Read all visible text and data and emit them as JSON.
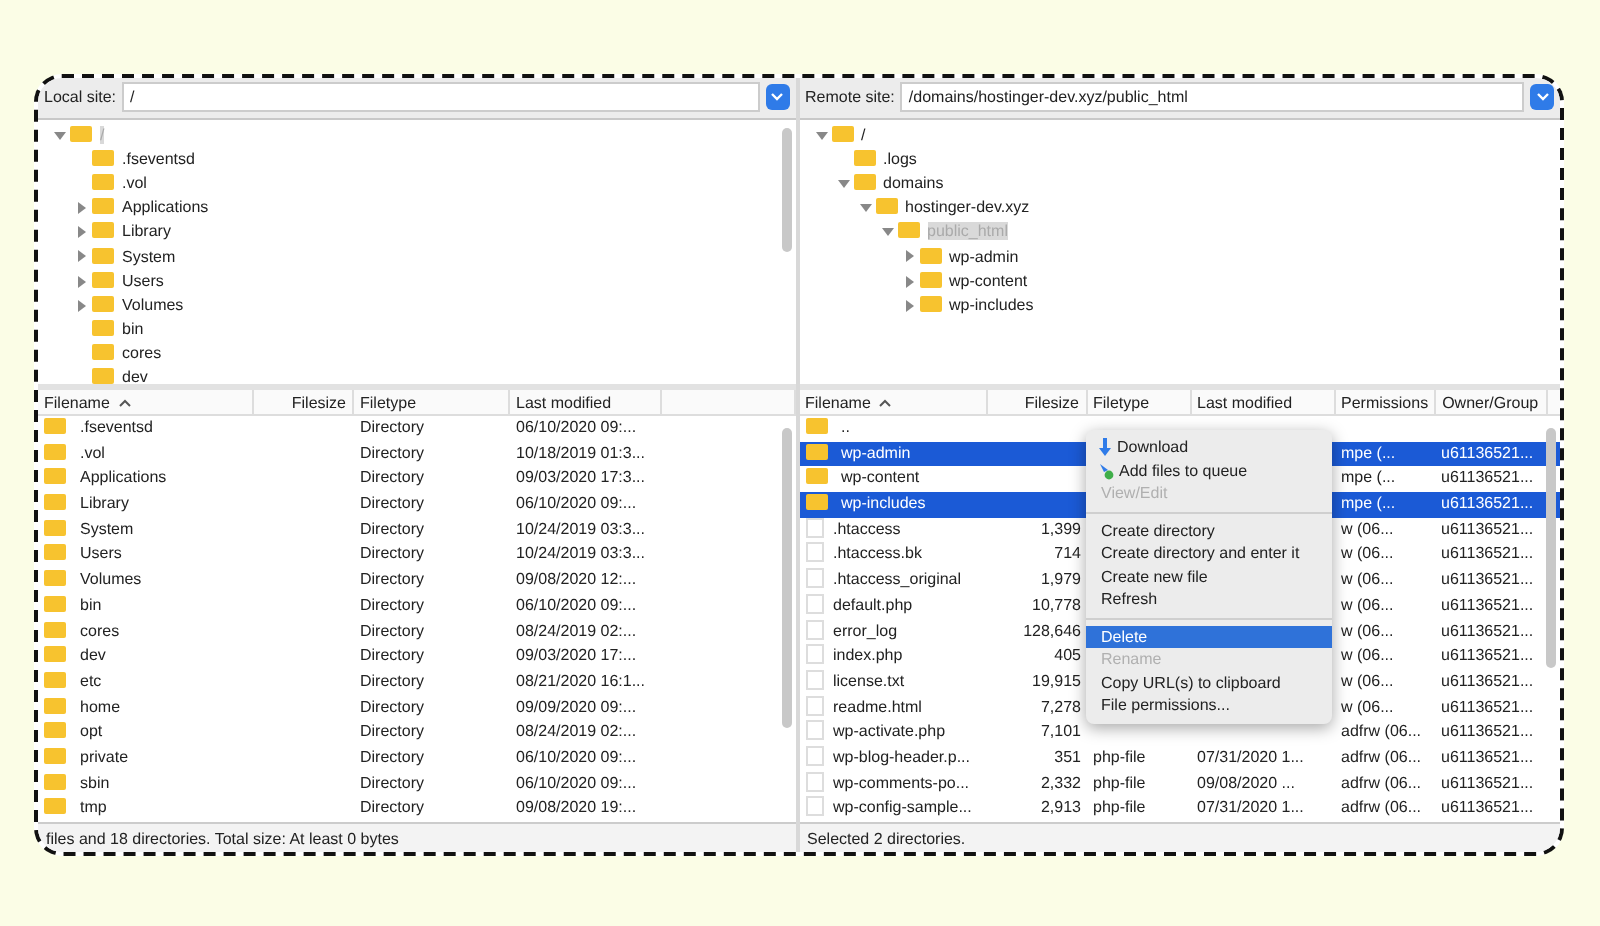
{
  "local": {
    "site_label": "Local site:",
    "path": "/",
    "tree": [
      {
        "label": "/",
        "expandable": true,
        "expanded": true,
        "selected": true,
        "children": [
          {
            "label": ".fseventsd",
            "expandable": false,
            "selected": false
          },
          {
            "label": ".vol",
            "expandable": false,
            "selected": false
          },
          {
            "label": "Applications",
            "expandable": true,
            "expanded": false,
            "selected": false
          },
          {
            "label": "Library",
            "expandable": true,
            "expanded": false,
            "selected": false
          },
          {
            "label": "System",
            "expandable": true,
            "expanded": false,
            "selected": false
          },
          {
            "label": "Users",
            "expandable": true,
            "expanded": false,
            "selected": false
          },
          {
            "label": "Volumes",
            "expandable": true,
            "expanded": false,
            "selected": false
          },
          {
            "label": "bin",
            "expandable": false,
            "selected": false
          },
          {
            "label": "cores",
            "expandable": false,
            "selected": false
          },
          {
            "label": "dev",
            "expandable": false,
            "selected": false
          }
        ]
      }
    ],
    "columns": [
      {
        "label": "Filename",
        "sorted": true
      },
      {
        "label": "Filesize",
        "sorted": false
      },
      {
        "label": "Filetype",
        "sorted": false
      },
      {
        "label": "Last modified",
        "sorted": false
      }
    ],
    "rows": [
      {
        "kind": "folder",
        "selected": false,
        "filename": ".fseventsd",
        "filetype": "Directory",
        "last_modified": "06/10/2020 09:..."
      },
      {
        "kind": "folder",
        "selected": false,
        "filename": ".vol",
        "filetype": "Directory",
        "last_modified": "10/18/2019 01:3..."
      },
      {
        "kind": "folder",
        "selected": false,
        "filename": "Applications",
        "filetype": "Directory",
        "last_modified": "09/03/2020 17:3..."
      },
      {
        "kind": "folder",
        "selected": false,
        "filename": "Library",
        "filetype": "Directory",
        "last_modified": "06/10/2020 09:..."
      },
      {
        "kind": "folder",
        "selected": false,
        "filename": "System",
        "filetype": "Directory",
        "last_modified": "10/24/2019 03:3..."
      },
      {
        "kind": "folder",
        "selected": false,
        "filename": "Users",
        "filetype": "Directory",
        "last_modified": "10/24/2019 03:3..."
      },
      {
        "kind": "folder",
        "selected": false,
        "filename": "Volumes",
        "filetype": "Directory",
        "last_modified": "09/08/2020 12:..."
      },
      {
        "kind": "folder",
        "selected": false,
        "filename": "bin",
        "filetype": "Directory",
        "last_modified": "06/10/2020 09:..."
      },
      {
        "kind": "folder",
        "selected": false,
        "filename": "cores",
        "filetype": "Directory",
        "last_modified": "08/24/2019 02:..."
      },
      {
        "kind": "folder",
        "selected": false,
        "filename": "dev",
        "filetype": "Directory",
        "last_modified": "09/03/2020 17:..."
      },
      {
        "kind": "folder",
        "selected": false,
        "filename": "etc",
        "filetype": "Directory",
        "last_modified": "08/21/2020 16:1..."
      },
      {
        "kind": "folder",
        "selected": false,
        "filename": "home",
        "filetype": "Directory",
        "last_modified": "09/09/2020 09:..."
      },
      {
        "kind": "folder",
        "selected": false,
        "filename": "opt",
        "filetype": "Directory",
        "last_modified": "08/24/2019 02:..."
      },
      {
        "kind": "folder",
        "selected": false,
        "filename": "private",
        "filetype": "Directory",
        "last_modified": "06/10/2020 09:..."
      },
      {
        "kind": "folder",
        "selected": false,
        "filename": "sbin",
        "filetype": "Directory",
        "last_modified": "06/10/2020 09:..."
      },
      {
        "kind": "folder",
        "selected": false,
        "filename": "tmp",
        "filetype": "Directory",
        "last_modified": "09/08/2020 19:..."
      }
    ],
    "status": "files and 18 directories. Total size: At least 0 bytes"
  },
  "remote": {
    "site_label": "Remote site:",
    "path": "/domains/hostinger-dev.xyz/public_html",
    "tree": [
      {
        "label": "/",
        "expandable": true,
        "expanded": true,
        "selected": false,
        "children": [
          {
            "label": ".logs",
            "expandable": false,
            "selected": false
          },
          {
            "label": "domains",
            "expandable": true,
            "expanded": true,
            "selected": false,
            "children": [
              {
                "label": "hostinger-dev.xyz",
                "expandable": true,
                "expanded": true,
                "selected": false,
                "children": [
                  {
                    "label": "public_html",
                    "expandable": true,
                    "expanded": true,
                    "selected": true,
                    "children": [
                      {
                        "label": "wp-admin",
                        "expandable": true,
                        "expanded": false,
                        "selected": false
                      },
                      {
                        "label": "wp-content",
                        "expandable": true,
                        "expanded": false,
                        "selected": false
                      },
                      {
                        "label": "wp-includes",
                        "expandable": true,
                        "expanded": false,
                        "selected": false
                      }
                    ]
                  }
                ]
              }
            ]
          }
        ]
      }
    ],
    "columns": [
      {
        "label": "Filename",
        "sorted": true
      },
      {
        "label": "Filesize",
        "sorted": false
      },
      {
        "label": "Filetype",
        "sorted": false
      },
      {
        "label": "Last modified",
        "sorted": false
      },
      {
        "label": "Permissions",
        "sorted": false
      },
      {
        "label": "Owner/Group",
        "sorted": false
      }
    ],
    "rows": [
      {
        "kind": "folder",
        "selected": false,
        "filename": ".."
      },
      {
        "kind": "folder",
        "selected": true,
        "filename": "wp-admin",
        "permissions": "mpe (...",
        "owner_group": "u61136521..."
      },
      {
        "kind": "folder",
        "selected": false,
        "filename": "wp-content",
        "permissions": "mpe (...",
        "owner_group": "u61136521..."
      },
      {
        "kind": "folder",
        "selected": true,
        "filename": "wp-includes",
        "permissions": "mpe (...",
        "owner_group": "u61136521..."
      },
      {
        "kind": "file",
        "selected": false,
        "filename": ".htaccess",
        "filesize": "1,399",
        "permissions": "w (06...",
        "owner_group": "u61136521..."
      },
      {
        "kind": "file",
        "selected": false,
        "filename": ".htaccess.bk",
        "filesize": "714",
        "permissions": "w (06...",
        "owner_group": "u61136521..."
      },
      {
        "kind": "file",
        "selected": false,
        "filename": ".htaccess_original",
        "filesize": "1,979",
        "permissions": "w (06...",
        "owner_group": "u61136521..."
      },
      {
        "kind": "file",
        "selected": false,
        "filename": "default.php",
        "filesize": "10,778",
        "permissions": "w (06...",
        "owner_group": "u61136521..."
      },
      {
        "kind": "file",
        "selected": false,
        "filename": "error_log",
        "filesize": "128,646",
        "permissions": "w (06...",
        "owner_group": "u61136521..."
      },
      {
        "kind": "file",
        "selected": false,
        "filename": "index.php",
        "filesize": "405",
        "permissions": "w (06...",
        "owner_group": "u61136521..."
      },
      {
        "kind": "file",
        "selected": false,
        "filename": "license.txt",
        "filesize": "19,915",
        "permissions": "w (06...",
        "owner_group": "u61136521..."
      },
      {
        "kind": "file",
        "selected": false,
        "filename": "readme.html",
        "filesize": "7,278",
        "permissions": "w (06...",
        "owner_group": "u61136521..."
      },
      {
        "kind": "file",
        "selected": false,
        "filename": "wp-activate.php",
        "filesize": "7,101",
        "permissions": "adfrw (06...",
        "owner_group": "u61136521..."
      },
      {
        "kind": "file",
        "selected": false,
        "filename": "wp-blog-header.p...",
        "filesize": "351",
        "filetype": "php-file",
        "last_modified": "07/31/2020 1...",
        "permissions": "adfrw (06...",
        "owner_group": "u61136521..."
      },
      {
        "kind": "file",
        "selected": false,
        "filename": "wp-comments-po...",
        "filesize": "2,332",
        "filetype": "php-file",
        "last_modified": "09/08/2020 ...",
        "permissions": "adfrw (06...",
        "owner_group": "u61136521..."
      },
      {
        "kind": "file",
        "selected": false,
        "filename": "wp-config-sample...",
        "filesize": "2,913",
        "filetype": "php-file",
        "last_modified": "07/31/2020 1...",
        "permissions": "adfrw (06...",
        "owner_group": "u61136521..."
      }
    ],
    "context_menu": [
      {
        "kind": "item",
        "label": "Download",
        "has_icon": true,
        "disabled": false,
        "selected": false
      },
      {
        "kind": "item",
        "label": "Add files to queue",
        "has_icon": true,
        "disabled": false,
        "selected": false
      },
      {
        "kind": "item",
        "label": "View/Edit",
        "has_icon": false,
        "disabled": true,
        "selected": false
      },
      {
        "kind": "separator"
      },
      {
        "kind": "item",
        "label": "Create directory",
        "has_icon": false,
        "disabled": false,
        "selected": false
      },
      {
        "kind": "item",
        "label": "Create directory and enter it",
        "has_icon": false,
        "disabled": false,
        "selected": false
      },
      {
        "kind": "item",
        "label": "Create new file",
        "has_icon": false,
        "disabled": false,
        "selected": false
      },
      {
        "kind": "item",
        "label": "Refresh",
        "has_icon": false,
        "disabled": false,
        "selected": false
      },
      {
        "kind": "separator"
      },
      {
        "kind": "item",
        "label": "Delete",
        "has_icon": false,
        "disabled": false,
        "selected": true
      },
      {
        "kind": "item",
        "label": "Rename",
        "has_icon": false,
        "disabled": true,
        "selected": false
      },
      {
        "kind": "item",
        "label": "Copy URL(s) to clipboard",
        "has_icon": false,
        "disabled": false,
        "selected": false
      },
      {
        "kind": "item",
        "label": "File permissions...",
        "has_icon": false,
        "disabled": false,
        "selected": false
      }
    ],
    "status": "Selected 2 directories."
  }
}
